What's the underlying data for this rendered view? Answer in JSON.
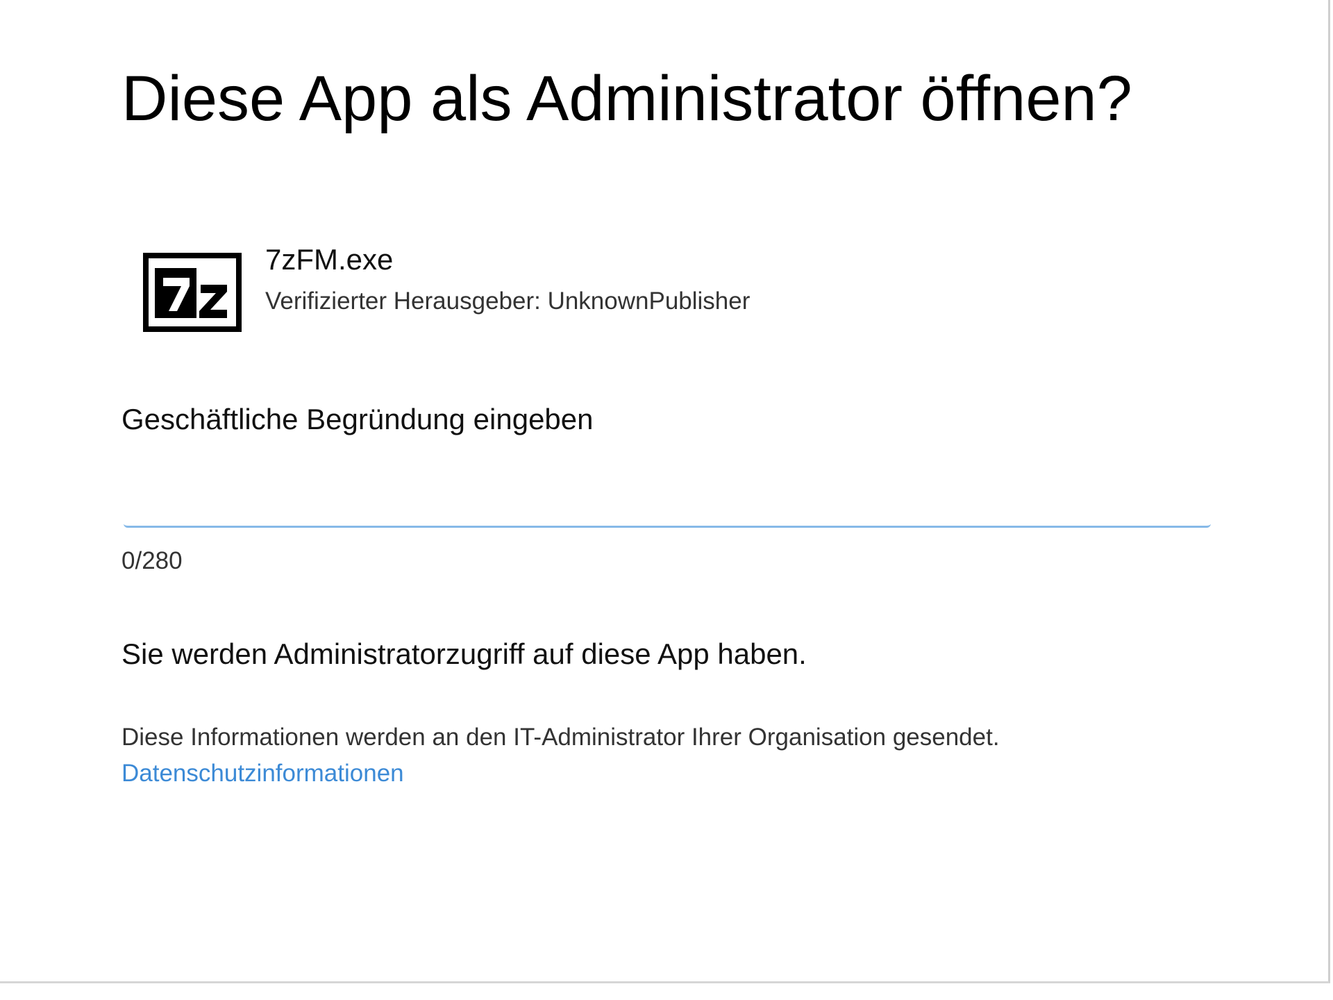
{
  "dialog": {
    "title": "Diese App als Administrator öffnen?",
    "app": {
      "icon": "7zip-app-icon",
      "icon_text": "7z",
      "name": "7zFM.exe",
      "publisher": "Verifizierter Herausgeber: UnknownPublisher"
    },
    "reason": {
      "label": "Geschäftliche Begründung eingeben",
      "value": "",
      "placeholder": "",
      "char_count": "0/280"
    },
    "access_note": "Sie werden Administratorzugriff auf diese App haben.",
    "info_text": "Diese Informationen werden an den IT-Administrator Ihrer Organisation gesendet.",
    "privacy_link": "Datenschutzinformationen"
  },
  "colors": {
    "background": "#ffffff",
    "text": "#111111",
    "secondary_text": "#333333",
    "link": "#3c8ad6",
    "input_underline": "#86b9e8"
  }
}
